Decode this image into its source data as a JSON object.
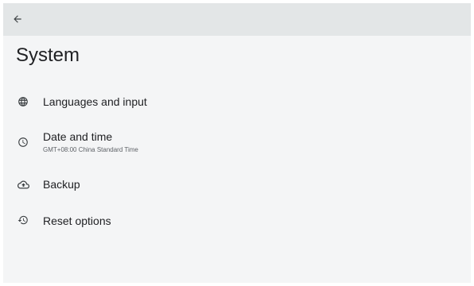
{
  "header": {
    "back_icon": "arrow-back-icon"
  },
  "page": {
    "title": "System"
  },
  "items": [
    {
      "icon": "globe-icon",
      "label": "Languages and input"
    },
    {
      "icon": "clock-icon",
      "label": "Date and time",
      "summary": "GMT+08:00 China Standard Time"
    },
    {
      "icon": "cloud-upload-icon",
      "label": "Backup"
    },
    {
      "icon": "history-icon",
      "label": "Reset options"
    }
  ],
  "colors": {
    "topbar": "#e3e6e7",
    "background": "#f4f5f6",
    "text_primary": "#202124",
    "text_secondary": "#5f6368",
    "icon": "#3c4043"
  }
}
